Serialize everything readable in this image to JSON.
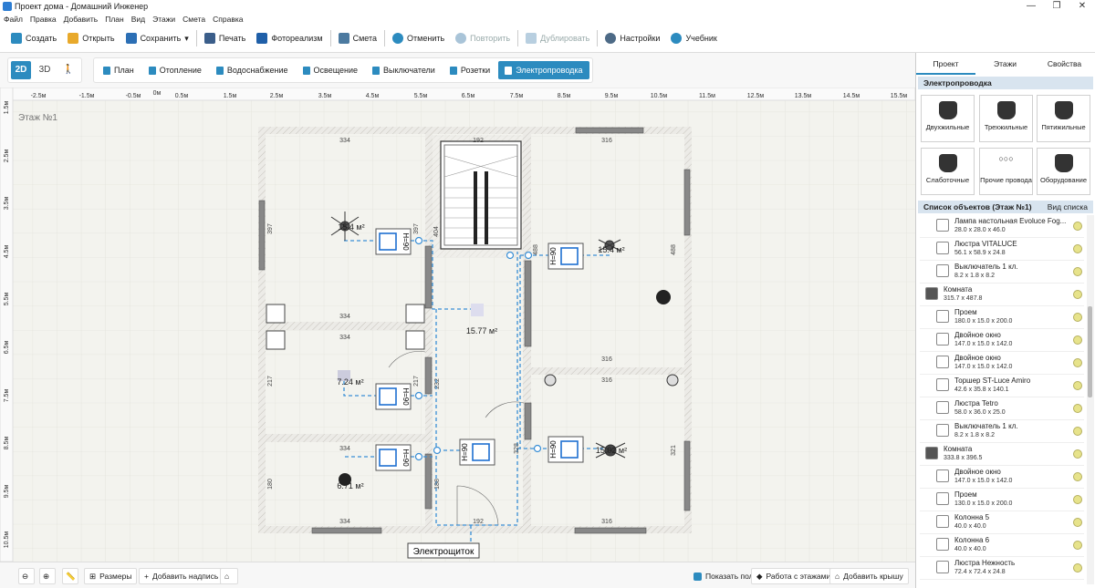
{
  "window": {
    "title": "Проект дома - Домашний Инженер",
    "controls": [
      "—",
      "❐",
      "✕"
    ]
  },
  "menu": [
    "Файл",
    "Правка",
    "Добавить",
    "План",
    "Вид",
    "Этажи",
    "Смета",
    "Справка"
  ],
  "toolbar": {
    "create": "Создать",
    "open": "Открыть",
    "save": "Сохранить",
    "save_arrow": "▾",
    "print": "Печать",
    "photoreal": "Фотореализм",
    "estimate": "Смета",
    "undo": "Отменить",
    "redo": "Повторить",
    "duplicate": "Дублировать",
    "settings": "Настройки",
    "tutorial": "Учебник"
  },
  "view": {
    "2d": "2D",
    "3d": "3D"
  },
  "modes": [
    "План",
    "Отопление",
    "Водоснабжение",
    "Освещение",
    "Выключатели",
    "Розетки",
    "Электропроводка"
  ],
  "ruler": {
    "top": [
      "-2.5м",
      "-1.5м",
      "-0.5м",
      "0м",
      "0.5м",
      "1.5м",
      "2.5м",
      "3.5м",
      "4.5м",
      "5.5м",
      "6.5м",
      "7.5м",
      "8.5м",
      "9.5м",
      "10.5м",
      "11.5м",
      "12.5м",
      "13.5м",
      "14.5м",
      "15.5м"
    ],
    "left": [
      "1.5м",
      "2.5м",
      "3.5м",
      "4.5м",
      "5.5м",
      "6.5м",
      "7.5м",
      "8.5м",
      "9.5м",
      "10.5м"
    ]
  },
  "floor_label": "Этаж №1",
  "plan": {
    "dims": [
      "334",
      "192",
      "316",
      "397",
      "397",
      "404",
      "488",
      "488",
      "334",
      "334",
      "217",
      "217",
      "232",
      "316",
      "316",
      "334",
      "180",
      "188",
      "321",
      "334",
      "192",
      "316",
      "328"
    ],
    "areas": [
      "15.4 м²",
      "15.4 м²",
      "15.77 м²",
      "7.24 м²",
      "6.71 м²",
      "15.02 м²"
    ],
    "switch_label": "H=90",
    "panel_label": "Электрощиток"
  },
  "bottom": {
    "dimensions": "Размеры",
    "add_label": "Добавить надпись",
    "show_floor": "Показать пол",
    "floors": "Работа с этажами",
    "add_roof": "Добавить крышу"
  },
  "side_panel": {
    "tabs": [
      "Проект",
      "Этажи",
      "Свойства"
    ],
    "section": "Электропроводка",
    "categories": [
      {
        "label": "Двухжильные"
      },
      {
        "label": "Трехжильные"
      },
      {
        "label": "Пятижильные"
      },
      {
        "label": "Слаботочные"
      },
      {
        "label": "Прочие провода"
      },
      {
        "label": "Оборудование"
      }
    ],
    "list_title": "Список объектов (Этаж №1)",
    "list_view": "Вид списка",
    "objects": [
      {
        "name": "Лампа настольная Evoluce Fog...",
        "dims": "28.0 x 28.0 x 46.0",
        "icon": "lamp-icon"
      },
      {
        "name": "Люстра VITALUCE",
        "dims": "56.1 x 58.9 x 24.8",
        "icon": "chandelier-icon"
      },
      {
        "name": "Выключатель 1 кл.",
        "dims": "8.2 x 1.8 x 8.2",
        "icon": "switch-icon"
      },
      {
        "name": "Комната",
        "dims": "315.7 x 487.8",
        "icon": "room-icon"
      },
      {
        "name": "Проем",
        "dims": "180.0 x 15.0 x 200.0",
        "icon": "opening-icon"
      },
      {
        "name": "Двойное окно",
        "dims": "147.0 x 15.0 x 142.0",
        "icon": "window-icon"
      },
      {
        "name": "Двойное окно",
        "dims": "147.0 x 15.0 x 142.0",
        "icon": "window-icon"
      },
      {
        "name": "Торшер ST-Luce Amiro",
        "dims": "42.6 x 35.8 x 140.1",
        "icon": "floor-lamp-icon"
      },
      {
        "name": "Люстра Tetro",
        "dims": "58.0 x 36.0 x 25.0",
        "icon": "chandelier-icon"
      },
      {
        "name": "Выключатель 1 кл.",
        "dims": "8.2 x 1.8 x 8.2",
        "icon": "switch-icon"
      },
      {
        "name": "Комната",
        "dims": "333.8 x 396.5",
        "icon": "room-icon"
      },
      {
        "name": "Двойное окно",
        "dims": "147.0 x 15.0 x 142.0",
        "icon": "window-icon"
      },
      {
        "name": "Проем",
        "dims": "130.0 x 15.0 x 200.0",
        "icon": "opening-icon"
      },
      {
        "name": "Колонна 5",
        "dims": "40.0 x 40.0",
        "icon": "column-icon"
      },
      {
        "name": "Колонна 6",
        "dims": "40.0 x 40.0",
        "icon": "column-icon"
      },
      {
        "name": "Люстра Нежность",
        "dims": "72.4 x 72.4 x 24.8",
        "icon": "chandelier-icon"
      }
    ]
  },
  "colors": {
    "accent": "#2c8bbf",
    "wire": "#3a8fd6",
    "wall": "#e4e2dd",
    "wall_hatch": "#c6c3bc"
  }
}
